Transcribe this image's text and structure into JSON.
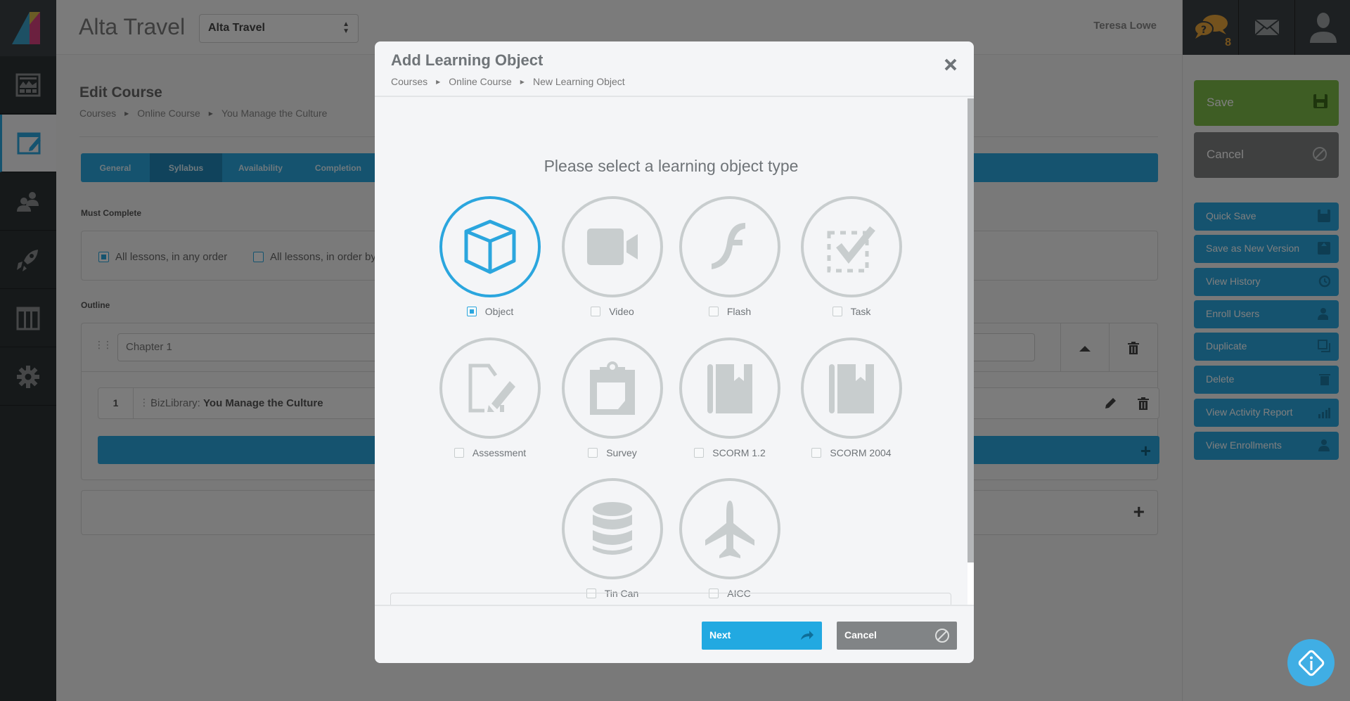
{
  "app": {
    "title": "Alta Travel",
    "org_select": {
      "value": "Alta Travel"
    },
    "user_name": "Teresa Lowe",
    "notification_count": "8"
  },
  "leftnav": {
    "items": [
      {
        "name": "dashboard",
        "icon": "dashboard-icon"
      },
      {
        "name": "edit-course",
        "icon": "edit-window-icon",
        "active": true
      },
      {
        "name": "users",
        "icon": "users-icon"
      },
      {
        "name": "launch",
        "icon": "rocket-icon"
      },
      {
        "name": "catalog",
        "icon": "columns-icon"
      },
      {
        "name": "settings",
        "icon": "gear-icon"
      }
    ]
  },
  "page": {
    "title": "Edit Course",
    "breadcrumb": [
      "Courses",
      "Online Course",
      "You Manage the Culture"
    ],
    "tabs": [
      "General",
      "Syllabus",
      "Availability",
      "Completion"
    ],
    "active_tab": "Syllabus",
    "must_complete": {
      "label": "Must Complete",
      "options": [
        {
          "label": "All lessons, in any order",
          "checked": true
        },
        {
          "label": "All lessons, in order by",
          "checked": false
        }
      ]
    },
    "outline": {
      "label": "Outline",
      "chapter_value": "Chapter 1",
      "lessons": [
        {
          "number": "1",
          "provider": "BizLibrary:",
          "title": "You Manage the Culture"
        }
      ]
    }
  },
  "rightpanel": {
    "save_label": "Save",
    "cancel_label": "Cancel",
    "actions": [
      {
        "label": "Quick Save",
        "icon": "floppy-icon"
      },
      {
        "label": "Save as New Version",
        "icon": "floppy-upload-icon"
      },
      {
        "label": "View History",
        "icon": "history-icon"
      },
      {
        "label": "Enroll Users",
        "icon": "add-user-icon"
      },
      {
        "label": "Duplicate",
        "icon": "duplicate-icon"
      },
      {
        "label": "Delete",
        "icon": "trash-icon"
      },
      {
        "label": "View Activity Report",
        "icon": "bar-chart-icon"
      },
      {
        "label": "View Enrollments",
        "icon": "user-icon"
      }
    ]
  },
  "modal": {
    "title": "Add Learning Object",
    "breadcrumb": [
      "Courses",
      "Online Course",
      "New Learning Object"
    ],
    "prompt": "Please select a learning object type",
    "types": [
      {
        "label": "Object",
        "icon": "cube-icon",
        "selected": true
      },
      {
        "label": "Video",
        "icon": "video-camera-icon",
        "selected": false
      },
      {
        "label": "Flash",
        "icon": "flash-icon",
        "selected": false
      },
      {
        "label": "Task",
        "icon": "task-check-icon",
        "selected": false
      },
      {
        "label": "Assessment",
        "icon": "assessment-icon",
        "selected": false
      },
      {
        "label": "Survey",
        "icon": "clipboard-icon",
        "selected": false
      },
      {
        "label": "SCORM 1.2",
        "icon": "book-icon",
        "selected": false
      },
      {
        "label": "SCORM 2004",
        "icon": "book-icon",
        "selected": false
      },
      {
        "label": "Tin Can",
        "icon": "database-icon",
        "selected": false
      },
      {
        "label": "AICC",
        "icon": "airplane-icon",
        "selected": false
      }
    ],
    "next_label": "Next",
    "cancel_label": "Cancel"
  },
  "colors": {
    "accent": "#2ba6de",
    "save_green": "#7dba49",
    "cancel_gray": "#7e8081",
    "notification": "#e8a43a"
  }
}
